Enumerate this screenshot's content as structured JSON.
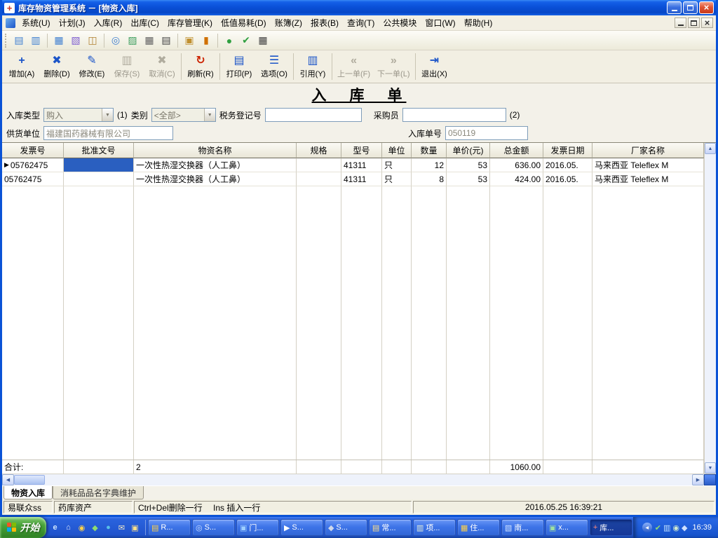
{
  "titlebar": {
    "title": "库存物资管理系统 － [物资入库]"
  },
  "menu": {
    "items": [
      "系统(U)",
      "计划(J)",
      "入库(R)",
      "出库(C)",
      "库存管理(K)",
      "低值易耗(D)",
      "账簿(Z)",
      "报表(B)",
      "查询(T)",
      "公共模块",
      "窗口(W)",
      "帮助(H)"
    ]
  },
  "toolbar_small": {
    "icons": [
      {
        "name": "new-doc-icon",
        "glyph": "▤",
        "color": "#3f7fd0"
      },
      {
        "name": "export-doc-icon",
        "glyph": "▥",
        "color": "#3f7fd0"
      },
      {
        "name": "table-view-icon",
        "glyph": "▦",
        "color": "#3f7fd0"
      },
      {
        "name": "form-view-icon",
        "glyph": "▧",
        "color": "#7f5fd0"
      },
      {
        "name": "modules-icon",
        "glyph": "◫",
        "color": "#b08030"
      },
      {
        "name": "search-icon",
        "glyph": "◎",
        "color": "#3f7fd0"
      },
      {
        "name": "chart-icon",
        "glyph": "▨",
        "color": "#3f9f5f"
      },
      {
        "name": "grid-icon",
        "glyph": "▦",
        "color": "#606060"
      },
      {
        "name": "print-icon",
        "glyph": "▤",
        "color": "#404040"
      },
      {
        "name": "folder-icon",
        "glyph": "▣",
        "color": "#c09030"
      },
      {
        "name": "thermometer-icon",
        "glyph": "▮",
        "color": "#d07000"
      },
      {
        "name": "sphere-icon",
        "glyph": "●",
        "color": "#30a040"
      },
      {
        "name": "check-icon",
        "glyph": "✔",
        "color": "#30a040"
      },
      {
        "name": "calculator-icon",
        "glyph": "▦",
        "color": "#3f3f3f"
      }
    ]
  },
  "toolbar": {
    "buttons": [
      {
        "name": "add-button",
        "icon": "add-icon",
        "glyph": "+",
        "color": "#1b54c8",
        "label": "增加(A)",
        "enabled": true
      },
      {
        "name": "delete-button",
        "icon": "delete-icon",
        "glyph": "✖",
        "color": "#1b54c8",
        "label": "删除(D)",
        "enabled": true
      },
      {
        "name": "modify-button",
        "icon": "modify-icon",
        "glyph": "✎",
        "color": "#1b54c8",
        "label": "修改(E)",
        "enabled": true
      },
      {
        "name": "save-button",
        "icon": "save-icon",
        "glyph": "▥",
        "color": "#9a968a",
        "label": "保存(S)",
        "enabled": false
      },
      {
        "name": "cancel-button",
        "icon": "cancel-icon",
        "glyph": "✖",
        "color": "#9a968a",
        "label": "取消(C)",
        "enabled": false
      },
      {
        "name": "refresh-button",
        "icon": "refresh-icon",
        "glyph": "↻",
        "color": "#cc2200",
        "label": "刷新(R)",
        "enabled": true
      },
      {
        "name": "print-button",
        "icon": "print-icon",
        "glyph": "▤",
        "color": "#1b54c8",
        "label": "打印(P)",
        "enabled": true
      },
      {
        "name": "options-button",
        "icon": "options-icon",
        "glyph": "☰",
        "color": "#1b54c8",
        "label": "选项(O)",
        "enabled": true
      },
      {
        "name": "reference-button",
        "icon": "reference-icon",
        "glyph": "▥",
        "color": "#1b54c8",
        "label": "引用(Y)",
        "enabled": true
      },
      {
        "name": "previous-button",
        "icon": "previous-icon",
        "glyph": "«",
        "color": "#7f9fd8",
        "label": "上一单(F)",
        "enabled": false
      },
      {
        "name": "next-button",
        "icon": "next-icon",
        "glyph": "»",
        "color": "#9a968a",
        "label": "下一单(L)",
        "enabled": false
      },
      {
        "name": "exit-button",
        "icon": "exit-icon",
        "glyph": "⇥",
        "color": "#1b54c8",
        "label": "退出(X)",
        "enabled": true
      }
    ]
  },
  "form": {
    "title": "入　库　单",
    "type_label": "入库类型",
    "type_value": "购入",
    "hint1": "(1)",
    "category_label": "类别",
    "category_value": "<全部>",
    "tax_label": "税务登记号",
    "tax_value": "",
    "buyer_label": "采购员",
    "buyer_value": "",
    "hint2": "(2)",
    "supplier_label": "供货单位",
    "supplier_value": "福建国药器械有限公司",
    "order_label": "入库单号",
    "order_value": "050119"
  },
  "table": {
    "columns": [
      "发票号",
      "批准文号",
      "物资名称",
      "规格",
      "型号",
      "单位",
      "数量",
      "单价(元)",
      "总金额",
      "发票日期",
      "厂家名称"
    ],
    "rows": [
      [
        "05762475",
        "",
        "一次性热湿交换器（人工鼻）",
        "",
        "41311",
        "只",
        "12",
        "53",
        "636.00",
        "2016.05.",
        "马来西亚 Teleflex M"
      ],
      [
        "05762475",
        "",
        "一次性热湿交换器（人工鼻）",
        "",
        "41311",
        "只",
        "8",
        "53",
        "424.00",
        "2016.05.",
        "马来西亚 Teleflex M"
      ]
    ],
    "footer": [
      "合计:",
      "",
      "2",
      "",
      "",
      "",
      "",
      "",
      "1060.00",
      "",
      ""
    ],
    "selection": {
      "row": 0,
      "col": 1
    },
    "current_row": 0,
    "current_row_indicator": "▶"
  },
  "tabs": {
    "items": [
      {
        "name": "materials-inbound",
        "label": "物资入库",
        "active": true
      },
      {
        "name": "consumables-dictionary",
        "label": "消耗品品名字典维护",
        "active": false
      }
    ]
  },
  "statusbar": {
    "panels": [
      {
        "name": "status-user",
        "text": "易联众ss"
      },
      {
        "name": "status-store",
        "text": "药库资产"
      },
      {
        "name": "status-hints",
        "text": "Ctrl+Del删除一行　 Ins 插入一行"
      },
      {
        "name": "status-datetime",
        "text": "2016.05.25 16:39:21"
      }
    ]
  },
  "taskbar": {
    "start_label": "开始",
    "quick_launch": [
      {
        "name": "internet-explorer-icon",
        "glyph": "e",
        "color": "#cfe6ff"
      },
      {
        "name": "show-desktop-icon",
        "glyph": "⌂",
        "color": "#e8f0ff"
      },
      {
        "name": "media-player-icon",
        "glyph": "◉",
        "color": "#ffd24a"
      },
      {
        "name": "messenger-icon",
        "glyph": "◆",
        "color": "#8fdc6f"
      },
      {
        "name": "browser-icon",
        "glyph": "●",
        "color": "#58c0e8"
      },
      {
        "name": "mail-icon",
        "glyph": "✉",
        "color": "#f0e8c8"
      },
      {
        "name": "folder-icon",
        "glyph": "▣",
        "color": "#ffe08a"
      }
    ],
    "windows": [
      {
        "name": "window-r",
        "label": "R...",
        "glyph": "▤",
        "color": "#ffd24a",
        "active": false
      },
      {
        "name": "window-s1",
        "label": "S...",
        "glyph": "◎",
        "color": "#cfe2ff",
        "active": false
      },
      {
        "name": "window-door",
        "label": "门...",
        "glyph": "▣",
        "color": "#9fd0ff",
        "active": false
      },
      {
        "name": "window-s2",
        "label": "S...",
        "glyph": "▶",
        "color": "#ffffff",
        "active": false
      },
      {
        "name": "window-s3",
        "label": "S...",
        "glyph": "◆",
        "color": "#cfd8ea",
        "active": false
      },
      {
        "name": "window-chang",
        "label": "常...",
        "glyph": "▤",
        "color": "#ffe08a",
        "active": false
      },
      {
        "name": "window-xiang",
        "label": "项...",
        "glyph": "▥",
        "color": "#e8f0d8",
        "active": false
      },
      {
        "name": "window-zhu",
        "label": "住...",
        "glyph": "▦",
        "color": "#ffd24a",
        "active": false
      },
      {
        "name": "window-nan",
        "label": "南...",
        "glyph": "▧",
        "color": "#cfe2ff",
        "active": false
      },
      {
        "name": "window-x",
        "label": "x...",
        "glyph": "▣",
        "color": "#9fe09f",
        "active": false
      },
      {
        "name": "window-ku",
        "label": "库...",
        "glyph": "+",
        "color": "#ff8a7a",
        "active": true
      }
    ],
    "tray": {
      "icons": [
        {
          "name": "antivirus-icon",
          "glyph": "✔",
          "color": "#8fdc6f"
        },
        {
          "name": "network-icon",
          "glyph": "▥",
          "color": "#bfe0ff"
        },
        {
          "name": "volume-icon",
          "glyph": "◉",
          "color": "#cfe8cf"
        },
        {
          "name": "im-icon",
          "glyph": "◆",
          "color": "#cfe0ff"
        }
      ],
      "time": "16:39"
    }
  }
}
